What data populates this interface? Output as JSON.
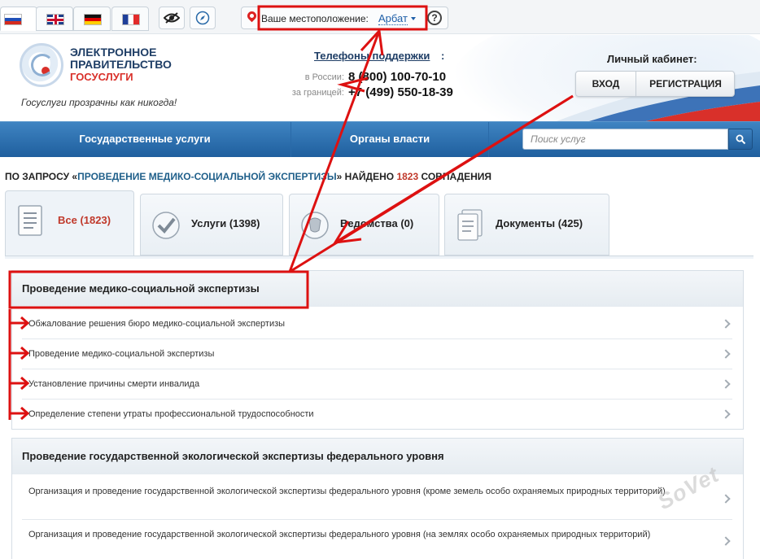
{
  "topbar": {
    "languages": [
      "ru",
      "en",
      "de",
      "fr"
    ],
    "tools": [
      "eye-icon",
      "compass-icon"
    ],
    "location": {
      "label": "Ваше местоположение:",
      "city": "Арбат",
      "help": "?"
    }
  },
  "header": {
    "logo_line1": "ЭЛЕКТРОННОЕ",
    "logo_line2": "ПРАВИТЕЛЬСТВО",
    "logo_line3": "ГОСУСЛУГИ",
    "slogan": "Госуслуги прозрачны как никогда!",
    "support_title": "Телефоны поддержки",
    "support_colon": ":",
    "phones": [
      {
        "label": "в России:",
        "number": "8 (800) 100-70-10"
      },
      {
        "label": "за границей:",
        "number": "+7 (499) 550-18-39"
      }
    ],
    "cabinet_title": "Личный кабинет:",
    "login_label": "ВХОД",
    "register_label": "РЕГИСТРАЦИЯ"
  },
  "nav": {
    "services": "Государственные услуги",
    "authorities": "Органы власти",
    "search_placeholder": "Поиск услуг"
  },
  "results": {
    "prefix": "По запросу «",
    "query": "проведение медико-социальной экспертизы",
    "middle": "» найдено ",
    "count": "1823",
    "suffix": " совпадения"
  },
  "tabs": [
    {
      "label": "Все (1823)",
      "icon": "list-document-icon",
      "active": true
    },
    {
      "label": "Услуги (1398)",
      "icon": "checkmark-icon",
      "active": false
    },
    {
      "label": "Ведомства (0)",
      "icon": "emblem-icon",
      "active": false
    },
    {
      "label": "Документы (425)",
      "icon": "documents-icon",
      "active": false
    }
  ],
  "groups": [
    {
      "title": "Проведение медико-социальной экспертизы",
      "items": [
        "Обжалование решения бюро медико-социальной экспертизы",
        "Проведение медико-социальной экспертизы",
        "Установление причины смерти инвалида",
        "Определение степени утраты профессиональной трудоспособности"
      ]
    },
    {
      "title": "Проведение государственной экологической экспертизы федерального уровня",
      "items": [
        "Организация и проведение государственной экологической экспертизы федерального уровня (кроме земель особо охраняемых природных территорий)",
        "Организация и проведение государственной экологической экспертизы федерального уровня (на землях особо охраняемых природных территорий)"
      ]
    }
  ],
  "watermark": "SoVet",
  "colors": {
    "nav_blue": "#2a6aa8",
    "annotation_red": "#dd1111",
    "count_red": "#c0392b",
    "link_blue": "#1f5fa8"
  }
}
